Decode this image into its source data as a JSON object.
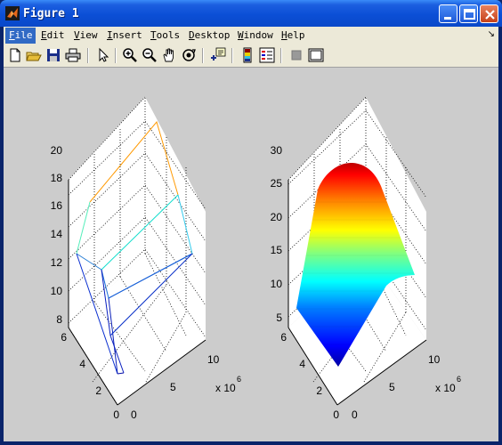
{
  "window": {
    "title": "Figure 1"
  },
  "menu": [
    {
      "label": "File",
      "key": "F",
      "rest": "ile"
    },
    {
      "label": "Edit",
      "key": "E",
      "rest": "dit"
    },
    {
      "label": "View",
      "key": "V",
      "rest": "iew"
    },
    {
      "label": "Insert",
      "key": "I",
      "rest": "nsert"
    },
    {
      "label": "Tools",
      "key": "T",
      "rest": "ools"
    },
    {
      "label": "Desktop",
      "key": "D",
      "rest": "esktop"
    },
    {
      "label": "Window",
      "key": "W",
      "rest": "indow"
    },
    {
      "label": "Help",
      "key": "H",
      "rest": "elp"
    }
  ],
  "toolbar_icons": [
    "new-figure-icon",
    "open-file-icon",
    "save-icon",
    "print-icon",
    "pointer-icon",
    "zoom-in-icon",
    "zoom-out-icon",
    "pan-hand-icon",
    "rotate-3d-icon",
    "data-cursor-icon",
    "colorbar-icon",
    "legend-icon",
    "hide-plot-tools-icon",
    "show-plot-tools-icon"
  ],
  "chart_data": [
    {
      "type": "line",
      "description_3d": "3-D line/mesh plot",
      "zlim": [
        8,
        20
      ],
      "zticks": [
        "8",
        "10",
        "12",
        "14",
        "16",
        "18",
        "20"
      ],
      "yticks": [
        "0",
        "2",
        "4",
        "6"
      ],
      "xticks": [
        "0",
        "5",
        "10"
      ],
      "x_exponent_label": "x 10",
      "x_exponent": "6"
    },
    {
      "type": "area",
      "description_3d": "3-D surface plot with jet colormap",
      "zlim": [
        5,
        30
      ],
      "zticks": [
        "5",
        "10",
        "15",
        "20",
        "25",
        "30"
      ],
      "yticks": [
        "0",
        "2",
        "4",
        "6"
      ],
      "xticks": [
        "0",
        "5",
        "10"
      ],
      "x_exponent_label": "x 10",
      "x_exponent": "6"
    }
  ]
}
